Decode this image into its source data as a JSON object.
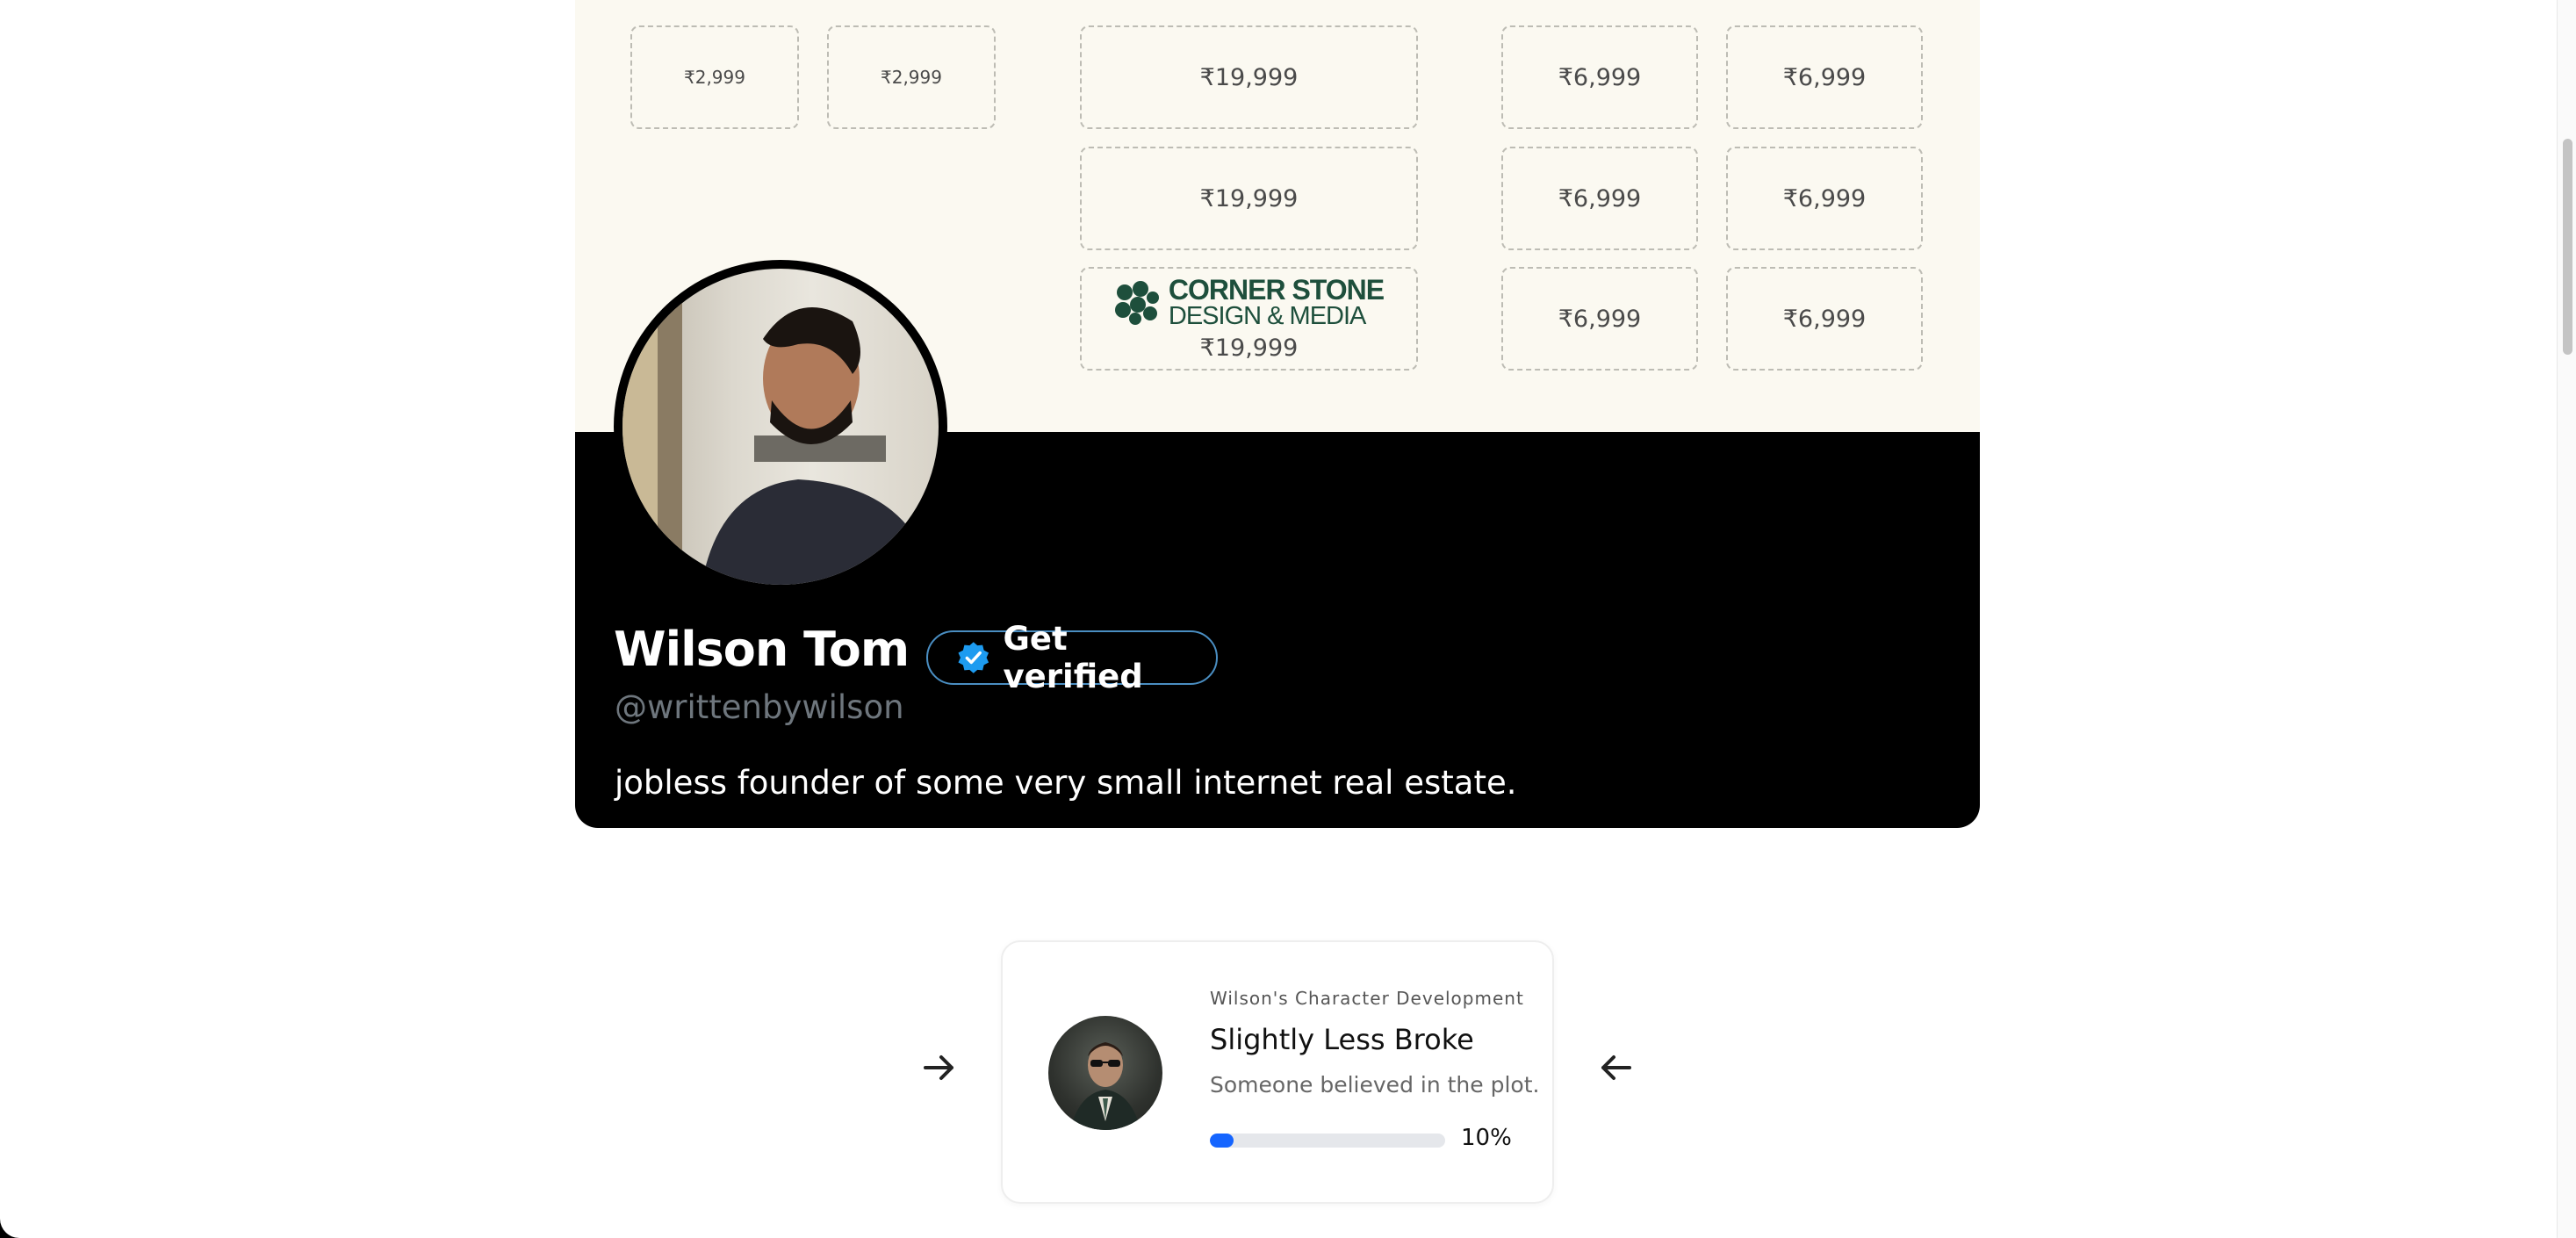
{
  "ad_board": {
    "slots": [
      {
        "price": "₹2,999"
      },
      {
        "price": "₹2,999"
      },
      {
        "price": "₹19,999"
      },
      {
        "price": "₹19,999"
      },
      {
        "price": "₹19,999",
        "logo_line1": "CORNER STONE",
        "logo_line2": "DESIGN & MEDIA"
      },
      {
        "price": "₹6,999"
      },
      {
        "price": "₹6,999"
      },
      {
        "price": "₹6,999"
      },
      {
        "price": "₹6,999"
      },
      {
        "price": "₹6,999"
      },
      {
        "price": "₹6,999"
      }
    ]
  },
  "profile": {
    "name": "Wilson Tom",
    "verify_label": "Get verified",
    "handle": "@writtenbywilson",
    "bio": "jobless founder of some very small internet real estate."
  },
  "progress_card": {
    "eyebrow": "Wilson's Character Development",
    "title": "Slightly Less Broke",
    "subtitle": "Someone believed in the plot.",
    "progress": 0.1,
    "progress_label": "10%"
  },
  "colors": {
    "banner_bg": "#fbf9f1",
    "verify_border": "#4a8ec2",
    "verified_badge": "#1d9bf0",
    "progress_fill": "#1565ff",
    "logo_green": "#1e4f3c"
  }
}
